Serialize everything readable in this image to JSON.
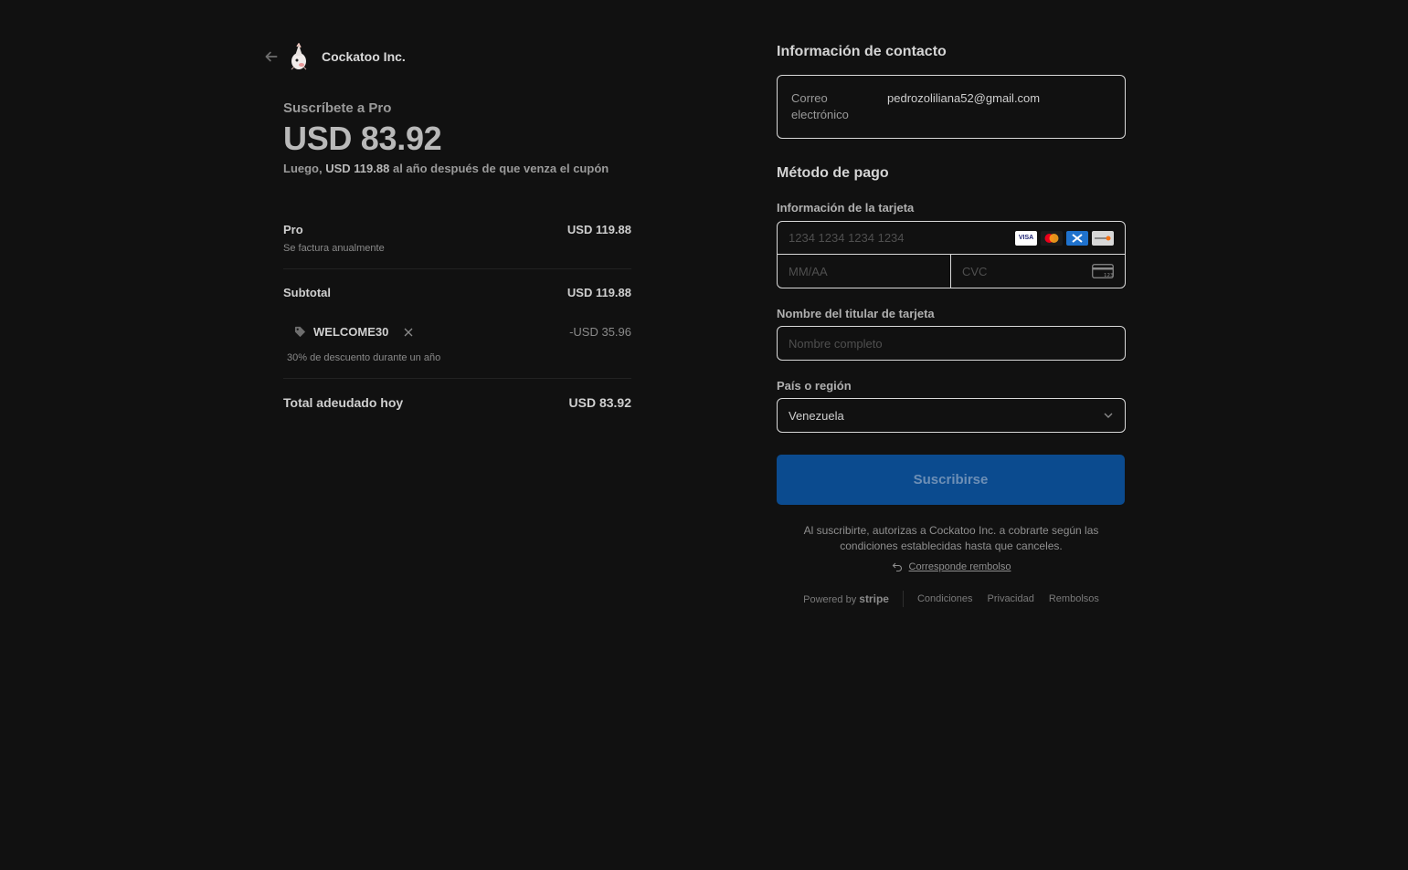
{
  "merchant": {
    "name": "Cockatoo Inc."
  },
  "summary": {
    "subscribe_to": "Suscríbete a Pro",
    "price": "USD 83.92",
    "then_prefix": "Luego,",
    "then_amount": "USD 119.88",
    "then_suffix": "al año después de que venza el cupón"
  },
  "items": {
    "pro_name": "Pro",
    "pro_price": "USD 119.88",
    "pro_billing": "Se factura anualmente",
    "subtotal_label": "Subtotal",
    "subtotal_value": "USD 119.88",
    "coupon_code": "WELCOME30",
    "coupon_discount": "-USD 35.96",
    "coupon_desc": "30% de descuento durante un año",
    "total_label": "Total adeudado hoy",
    "total_value": "USD 83.92"
  },
  "contact": {
    "title": "Información de contacto",
    "email_label": "Correo electrónico",
    "email_value": "pedrozoliliana52@gmail.com"
  },
  "payment": {
    "title": "Método de pago",
    "card_label": "Información de la tarjeta",
    "card_number_placeholder": "1234 1234 1234 1234",
    "expiry_placeholder": "MM/AA",
    "cvc_placeholder": "CVC",
    "brands": [
      "VISA",
      "Mastercard",
      "American Express",
      "Discover"
    ],
    "holder_label": "Nombre del titular de tarjeta",
    "holder_placeholder": "Nombre completo",
    "country_label": "País o región",
    "country_value": "Venezuela"
  },
  "actions": {
    "subscribe": "Suscribirse",
    "terms": "Al suscribirte, autorizas a Cockatoo Inc. a cobrarte según las condiciones establecidas hasta que canceles.",
    "refund_link": "Corresponde rembolso"
  },
  "footer": {
    "powered_by": "Powered by",
    "stripe": "stripe",
    "links": [
      "Condiciones",
      "Privacidad",
      "Rembolsos"
    ]
  },
  "colors": {
    "background": "#111111",
    "subscribe_bg": "#0b4b8f",
    "border": "#d9d9d9"
  }
}
